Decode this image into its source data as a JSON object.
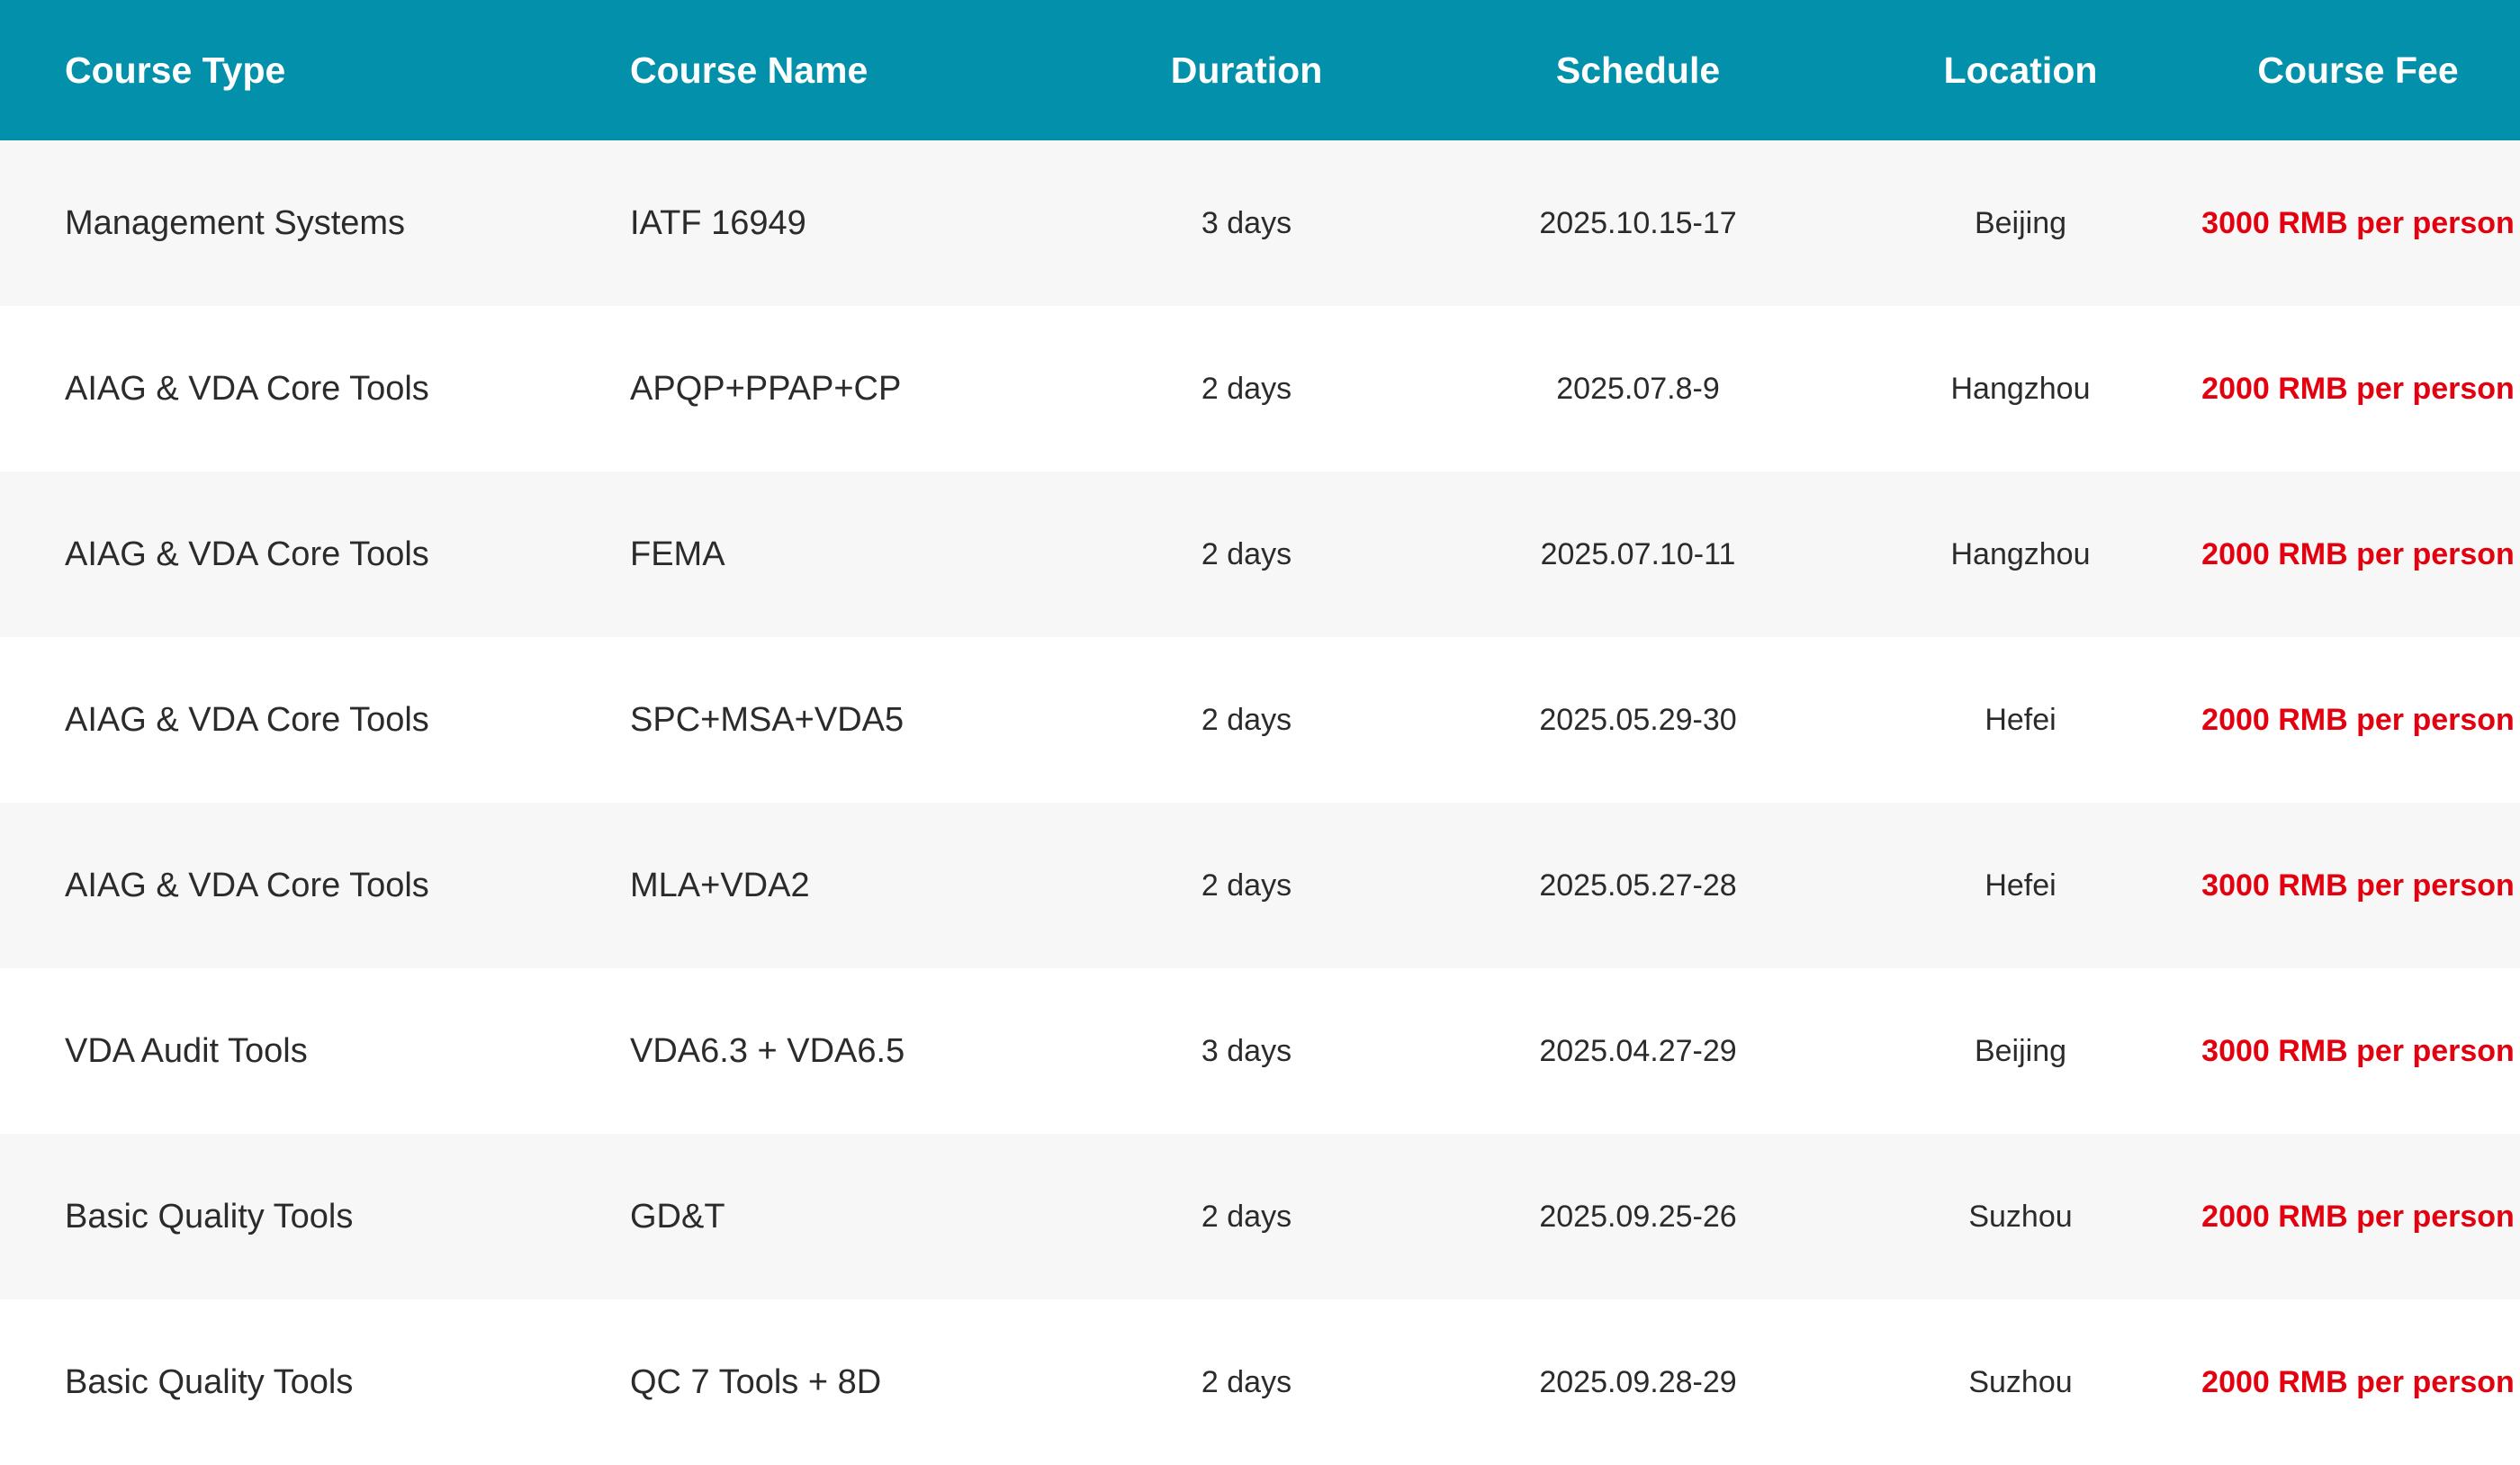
{
  "table": {
    "headers": [
      "Course Type",
      "Course Name",
      "Duration",
      "Schedule",
      "Location",
      "Course Fee"
    ],
    "rows": [
      [
        "Management Systems",
        "IATF 16949",
        "3 days",
        "2025.10.15-17",
        "Beijing",
        "3000 RMB per person"
      ],
      [
        "AIAG & VDA Core Tools",
        "APQP+PPAP+CP",
        "2 days",
        "2025.07.8-9",
        "Hangzhou",
        "2000 RMB per person"
      ],
      [
        "AIAG & VDA Core Tools",
        "FEMA",
        "2 days",
        "2025.07.10-11",
        "Hangzhou",
        "2000 RMB per person"
      ],
      [
        "AIAG & VDA Core Tools",
        "SPC+MSA+VDA5",
        "2 days",
        "2025.05.29-30",
        "Hefei",
        "2000 RMB per person"
      ],
      [
        "AIAG & VDA Core Tools",
        "MLA+VDA2",
        "2 days",
        "2025.05.27-28",
        "Hefei",
        "3000 RMB per person"
      ],
      [
        "VDA Audit Tools",
        "VDA6.3 + VDA6.5",
        "3 days",
        "2025.04.27-29",
        "Beijing",
        "3000 RMB per person"
      ],
      [
        "Basic Quality Tools",
        "GD&T",
        "2 days",
        "2025.09.25-26",
        "Suzhou",
        "2000 RMB per person"
      ],
      [
        "Basic Quality Tools",
        "QC 7 Tools + 8D",
        "2 days",
        "2025.09.28-29",
        "Suzhou",
        "2000 RMB per person"
      ]
    ]
  },
  "colors": {
    "header_bg": "#0390aa",
    "fee_text": "#e3000f",
    "row_stripe": "#f7f7f7"
  }
}
